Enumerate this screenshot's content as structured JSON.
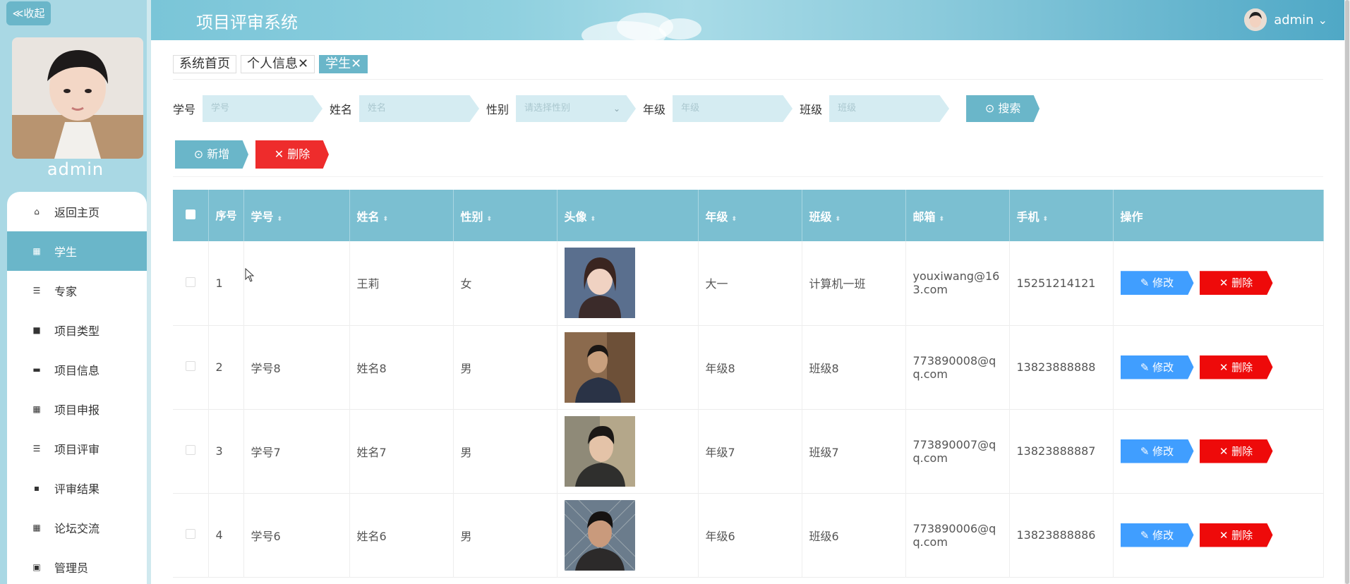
{
  "sidebar": {
    "collapse_label": "≪收起",
    "username": "admin",
    "items": [
      {
        "label": "返回主页",
        "icon": "home-icon",
        "glyph": "⌂"
      },
      {
        "label": "学生",
        "icon": "grid-icon",
        "glyph": "▦"
      },
      {
        "label": "专家",
        "icon": "list-icon",
        "glyph": "☰"
      },
      {
        "label": "项目类型",
        "icon": "briefcase-icon",
        "glyph": "■"
      },
      {
        "label": "项目信息",
        "icon": "monitor-icon",
        "glyph": "▬"
      },
      {
        "label": "项目申报",
        "icon": "apps-icon",
        "glyph": "▦"
      },
      {
        "label": "项目评审",
        "icon": "menu-icon",
        "glyph": "☰"
      },
      {
        "label": "评审结果",
        "icon": "comment-icon",
        "glyph": "▪"
      },
      {
        "label": "论坛交流",
        "icon": "apps-icon",
        "glyph": "▦"
      },
      {
        "label": "管理员",
        "icon": "clipboard-icon",
        "glyph": "▣"
      }
    ],
    "active_index": 1
  },
  "header": {
    "title": "项目评审系统",
    "user": "admin",
    "user_caret": "⌄"
  },
  "tabs": [
    {
      "label": "系统首页"
    },
    {
      "label": "个人信息✕"
    },
    {
      "label": "学生✕"
    }
  ],
  "search": {
    "fields": [
      {
        "label": "学号",
        "placeholder": "学号"
      },
      {
        "label": "姓名",
        "placeholder": "姓名"
      },
      {
        "label": "性别",
        "placeholder": "请选择性别"
      },
      {
        "label": "年级",
        "placeholder": "年级"
      },
      {
        "label": "班级",
        "placeholder": "班级"
      }
    ],
    "button": "⊙ 搜索"
  },
  "actions": {
    "add": "⊙ 新增",
    "delete": "✕ 删除"
  },
  "table": {
    "columns": [
      "序号",
      "学号",
      "姓名",
      "性别",
      "头像",
      "年级",
      "班级",
      "邮箱",
      "手机",
      "操作"
    ],
    "rows": [
      {
        "index": "1",
        "student_id": "",
        "name": "王莉",
        "gender": "女",
        "grade": "大一",
        "class": "计算机一班",
        "email": "youxiwang@163.com",
        "phone": "15251214121"
      },
      {
        "index": "2",
        "student_id": "学号8",
        "name": "姓名8",
        "gender": "男",
        "grade": "年级8",
        "class": "班级8",
        "email": "773890008@qq.com",
        "phone": "13823888888"
      },
      {
        "index": "3",
        "student_id": "学号7",
        "name": "姓名7",
        "gender": "男",
        "grade": "年级7",
        "class": "班级7",
        "email": "773890007@qq.com",
        "phone": "13823888887"
      },
      {
        "index": "4",
        "student_id": "学号6",
        "name": "姓名6",
        "gender": "男",
        "grade": "年级6",
        "class": "班级6",
        "email": "773890006@qq.com",
        "phone": "13823888886"
      }
    ],
    "edit_label": "✎ 修改",
    "delete_label": "✕ 删除"
  },
  "colors": {
    "accent": "#6ab6c9",
    "danger": "#ee2c2c",
    "primary_blue": "#409eff"
  }
}
